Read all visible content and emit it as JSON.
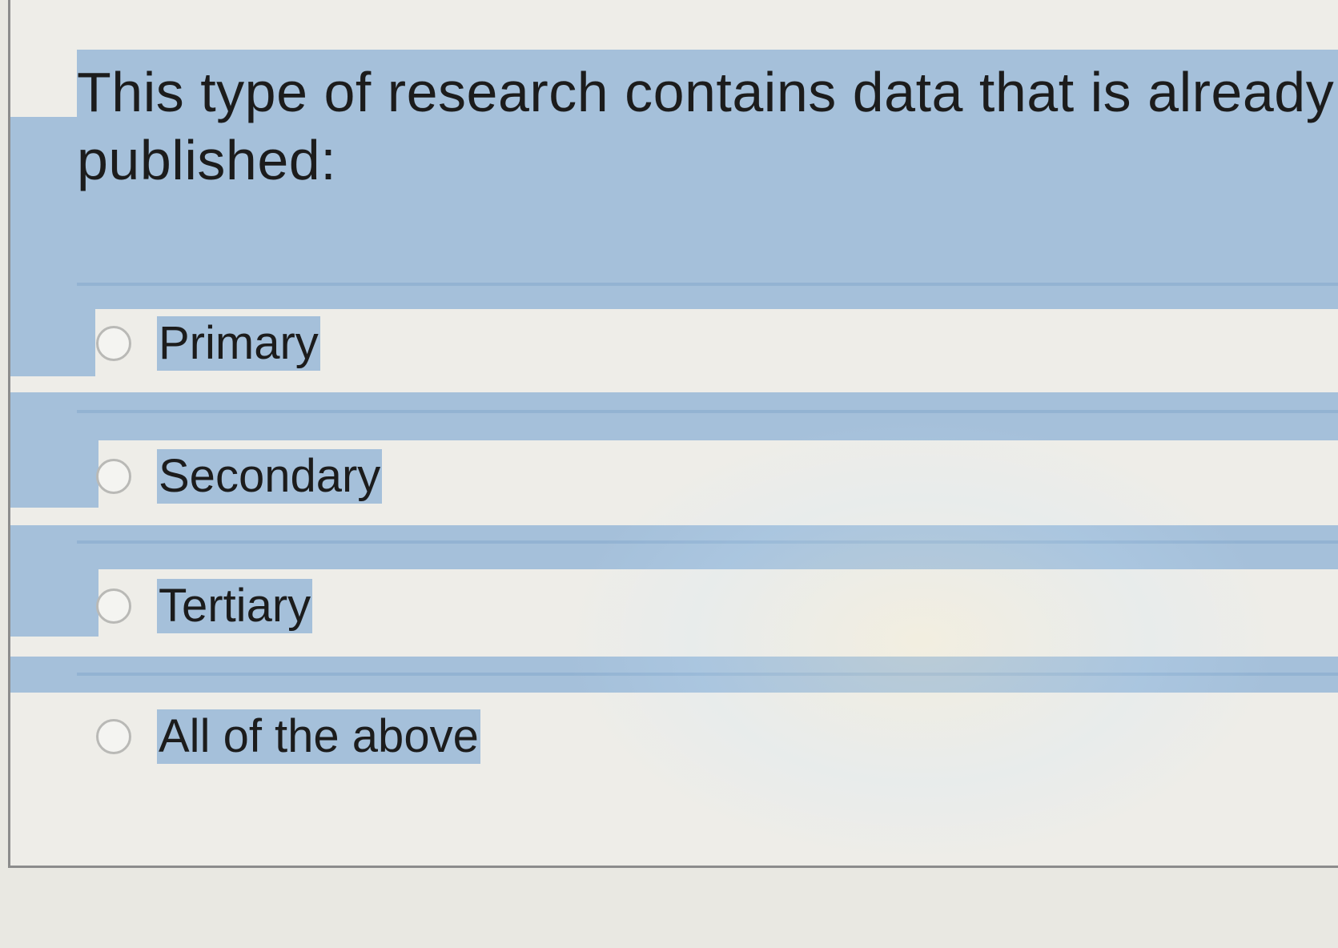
{
  "question": {
    "line1": "This type of research contains data that is already",
    "line2": "published:"
  },
  "options": [
    {
      "label": "Primary",
      "selected": false
    },
    {
      "label": "Secondary",
      "selected": false
    },
    {
      "label": "Tertiary",
      "selected": false
    },
    {
      "label": "All of the above",
      "selected": false
    }
  ],
  "colors": {
    "highlight": "#a5c0da",
    "page_background": "#e9e8e2",
    "radio_border": "#b9b9b6"
  }
}
